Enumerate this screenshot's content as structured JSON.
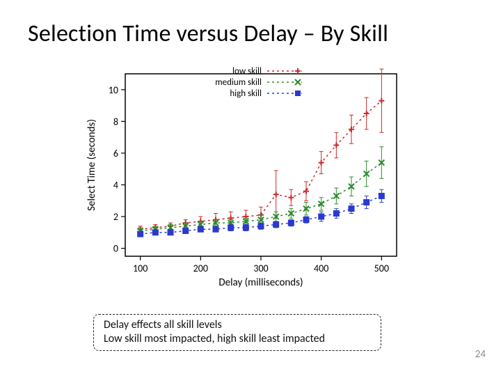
{
  "title": "Selection Time versus Delay – By Skill",
  "note": {
    "line1": "Delay effects all skill levels",
    "line2": "Low skill most impacted, high skill least impacted"
  },
  "page_number": "24",
  "legend": {
    "low": "low skill",
    "medium": "medium skill",
    "high": "high skill"
  },
  "axes": {
    "xlabel": "Delay (milliseconds)",
    "ylabel": "Select Time (seconds)"
  },
  "colors": {
    "low": "#cc2a2a",
    "medium": "#2a8a2a",
    "high": "#2a3acc",
    "axis": "#000000",
    "grid": "#000000"
  },
  "chart_data": {
    "type": "line",
    "title": "",
    "xlabel": "Delay (milliseconds)",
    "ylabel": "Select Time (seconds)",
    "xlim": [
      75,
      525
    ],
    "ylim": [
      -0.5,
      11
    ],
    "x_ticks": [
      100,
      200,
      300,
      400,
      500
    ],
    "y_ticks": [
      0,
      2,
      4,
      6,
      8,
      10
    ],
    "categories": [
      100,
      125,
      150,
      175,
      200,
      225,
      250,
      275,
      300,
      325,
      350,
      375,
      400,
      425,
      450,
      475,
      500
    ],
    "series": [
      {
        "name": "low skill",
        "color": "#cc2a2a",
        "marker": "plus",
        "values": [
          1.2,
          1.3,
          1.4,
          1.6,
          1.7,
          1.8,
          1.9,
          2.0,
          2.1,
          3.4,
          3.2,
          3.6,
          5.4,
          6.5,
          7.5,
          8.5,
          9.3
        ],
        "error": [
          0.2,
          0.2,
          0.2,
          0.2,
          0.3,
          0.4,
          0.4,
          0.4,
          0.5,
          1.5,
          0.5,
          0.6,
          0.7,
          0.8,
          0.9,
          1.0,
          2.0
        ]
      },
      {
        "name": "medium skill",
        "color": "#2a8a2a",
        "marker": "x",
        "values": [
          1.1,
          1.2,
          1.3,
          1.4,
          1.5,
          1.6,
          1.6,
          1.7,
          1.8,
          2.0,
          2.2,
          2.5,
          2.8,
          3.3,
          3.9,
          4.7,
          5.4
        ],
        "error": [
          0.2,
          0.2,
          0.2,
          0.2,
          0.2,
          0.2,
          0.2,
          0.2,
          0.3,
          0.3,
          0.3,
          0.4,
          0.4,
          0.5,
          0.6,
          0.8,
          1.0
        ]
      },
      {
        "name": "high skill",
        "color": "#2a3acc",
        "marker": "square",
        "values": [
          0.9,
          1.0,
          1.0,
          1.1,
          1.2,
          1.2,
          1.3,
          1.3,
          1.4,
          1.5,
          1.6,
          1.8,
          2.0,
          2.2,
          2.5,
          2.9,
          3.3
        ],
        "error": [
          0.1,
          0.1,
          0.1,
          0.1,
          0.1,
          0.1,
          0.2,
          0.2,
          0.2,
          0.2,
          0.2,
          0.2,
          0.3,
          0.3,
          0.3,
          0.4,
          0.4
        ]
      }
    ]
  }
}
